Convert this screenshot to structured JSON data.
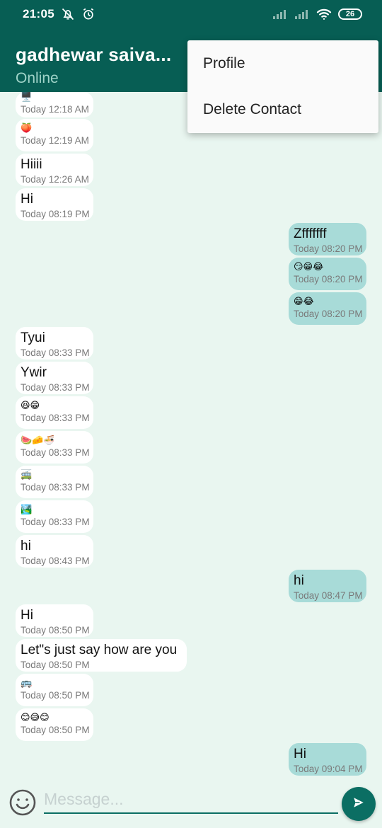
{
  "status_bar": {
    "time": "21:05",
    "battery": "26"
  },
  "header": {
    "name": "gadhewar saiva...",
    "status": "Online"
  },
  "menu": [
    {
      "label": "Profile"
    },
    {
      "label": "Delete Contact"
    }
  ],
  "messages": [
    {
      "dir": "in",
      "type": "emoji",
      "text": "🖥️",
      "time": "Today 12:18 AM"
    },
    {
      "dir": "in",
      "type": "emoji",
      "text": "🍑",
      "time": "Today 12:19 AM"
    },
    {
      "dir": "in",
      "type": "text",
      "text": "Hiiii",
      "time": "Today 12:26 AM"
    },
    {
      "dir": "in",
      "type": "text",
      "text": "Hi",
      "time": "Today 08:19 PM"
    },
    {
      "dir": "out",
      "type": "text",
      "text": "Zfffffff",
      "time": "Today 08:20 PM"
    },
    {
      "dir": "out",
      "type": "emoji",
      "text": "😏😁😂",
      "time": "Today 08:20 PM"
    },
    {
      "dir": "out",
      "type": "emoji",
      "text": "😁😂",
      "time": "Today 08:20 PM"
    },
    {
      "dir": "in",
      "type": "text",
      "text": "Tyui",
      "time": "Today 08:33 PM"
    },
    {
      "dir": "in",
      "type": "text",
      "text": "Ywir",
      "time": "Today 08:33 PM"
    },
    {
      "dir": "in",
      "type": "emoji",
      "text": "😆😁",
      "time": "Today 08:33 PM"
    },
    {
      "dir": "in",
      "type": "emoji",
      "text": "🍉🧀🍜",
      "time": "Today 08:33 PM"
    },
    {
      "dir": "in",
      "type": "emoji",
      "text": "🚎",
      "time": "Today 08:33 PM"
    },
    {
      "dir": "in",
      "type": "emoji",
      "text": "🏞️",
      "time": "Today 08:33 PM"
    },
    {
      "dir": "in",
      "type": "text",
      "text": "hi",
      "time": "Today 08:43 PM"
    },
    {
      "dir": "out",
      "type": "text",
      "text": "hi",
      "time": "Today 08:47 PM"
    },
    {
      "dir": "in",
      "type": "text",
      "text": "Hi",
      "time": "Today 08:50 PM"
    },
    {
      "dir": "in",
      "type": "text",
      "text": "Let\"s just say how are you",
      "time": "Today 08:50 PM"
    },
    {
      "dir": "in",
      "type": "emoji",
      "text": "🚌",
      "time": "Today 08:50 PM"
    },
    {
      "dir": "in",
      "type": "emoji",
      "text": "😊😅😊",
      "time": "Today 08:50 PM"
    },
    {
      "dir": "out",
      "type": "text",
      "text": "Hi",
      "time": "Today 09:04 PM"
    }
  ],
  "input": {
    "placeholder": "Message..."
  },
  "icons": {
    "emoji_button": "smiley-icon",
    "send_button": "send-icon",
    "status": [
      "mute-icon",
      "alarm-icon",
      "signal-icon",
      "signal-icon",
      "wifi-icon",
      "battery-icon"
    ]
  },
  "colors": {
    "primary": "#075e54",
    "chat_background": "#e9f6f0",
    "incoming_bubble": "#ffffff",
    "outgoing_bubble": "#a8dbd8",
    "accent": "#0b6e63"
  }
}
